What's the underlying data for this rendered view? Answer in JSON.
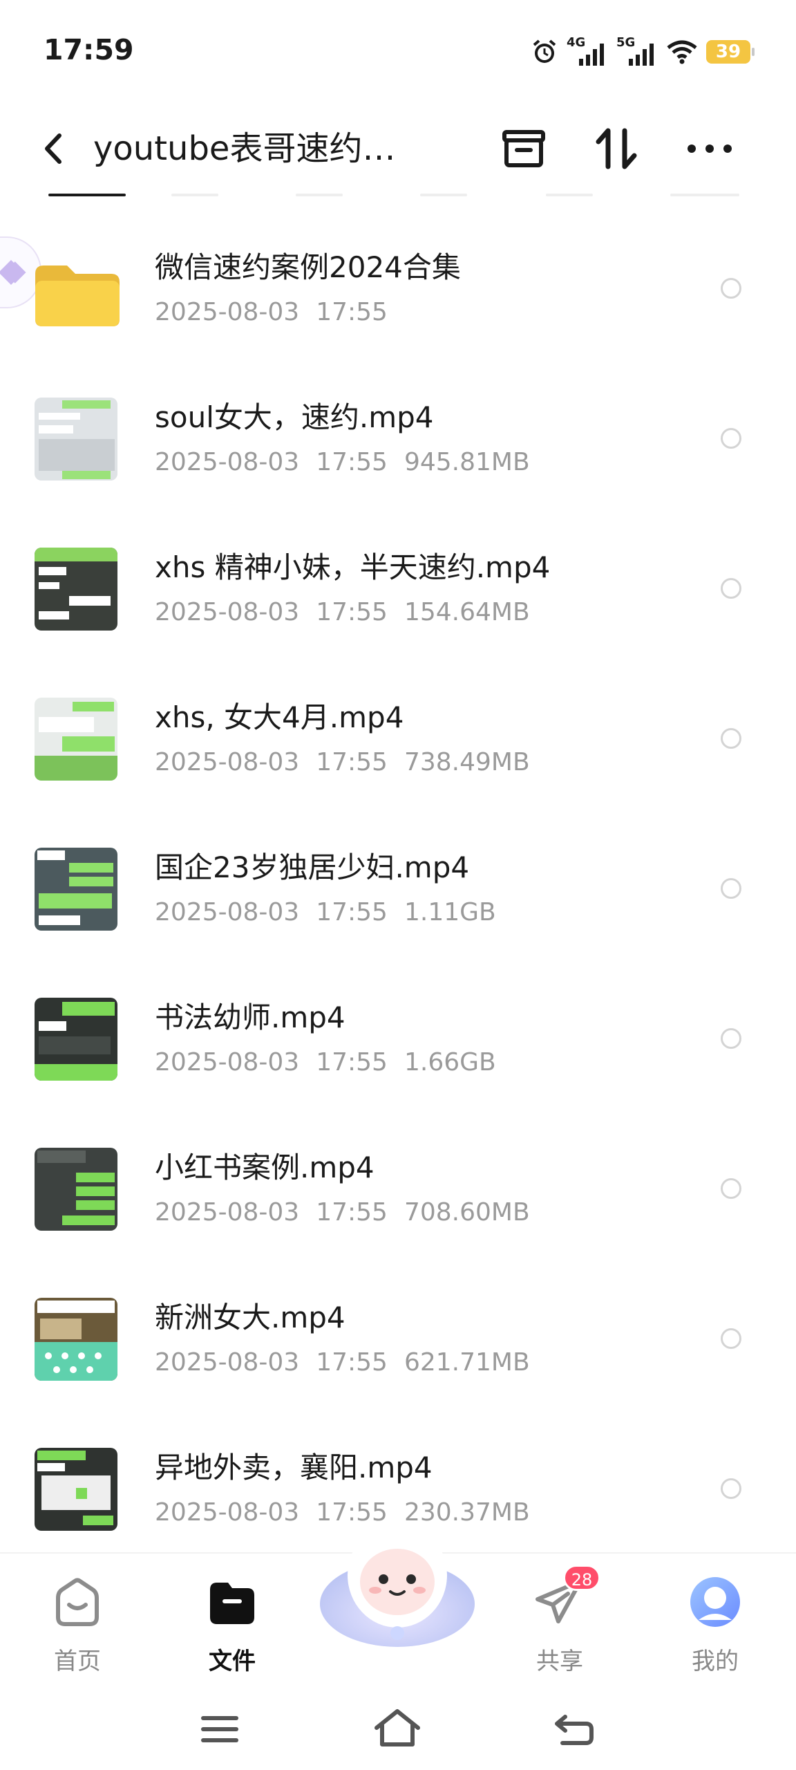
{
  "status_bar": {
    "time": "17:59",
    "network_1": "4G",
    "network_2": "5G",
    "battery": "39"
  },
  "header": {
    "title": "youtube表哥速约…",
    "back_icon": "chevron-left-icon",
    "archive_icon": "archive-icon",
    "sort_icon": "sort-icon",
    "more_icon": "more-horizontal-icon"
  },
  "files": [
    {
      "name": "微信速约案例2024合集",
      "date": "2025-08-03",
      "time": "17:55",
      "size": "",
      "type": "folder"
    },
    {
      "name": "soul女大，速约.mp4",
      "date": "2025-08-03",
      "time": "17:55",
      "size": "945.81MB",
      "type": "video"
    },
    {
      "name": "xhs 精神小妹，半天速约.mp4",
      "date": "2025-08-03",
      "time": "17:55",
      "size": "154.64MB",
      "type": "video"
    },
    {
      "name": "xhs, 女大4月.mp4",
      "date": "2025-08-03",
      "time": "17:55",
      "size": "738.49MB",
      "type": "video"
    },
    {
      "name": "国企23岁独居少妇.mp4",
      "date": "2025-08-03",
      "time": "17:55",
      "size": "1.11GB",
      "type": "video"
    },
    {
      "name": "书法幼师.mp4",
      "date": "2025-08-03",
      "time": "17:55",
      "size": "1.66GB",
      "type": "video"
    },
    {
      "name": "小红书案例.mp4",
      "date": "2025-08-03",
      "time": "17:55",
      "size": "708.60MB",
      "type": "video"
    },
    {
      "name": "新洲女大.mp4",
      "date": "2025-08-03",
      "time": "17:55",
      "size": "621.71MB",
      "type": "video"
    },
    {
      "name": "异地外卖，襄阳.mp4",
      "date": "2025-08-03",
      "time": "17:55",
      "size": "230.37MB",
      "type": "video"
    }
  ],
  "bottom_nav": {
    "home": "首页",
    "files": "文件",
    "share": "共享",
    "share_badge": "28",
    "me": "我的",
    "active": "files"
  },
  "colors": {
    "folder": "#f9d24a",
    "thumb_bg": "#3a3f3a",
    "chat_green": "#7ed957",
    "badge": "#ff4d6a",
    "meta_text": "#9a9a9a"
  }
}
